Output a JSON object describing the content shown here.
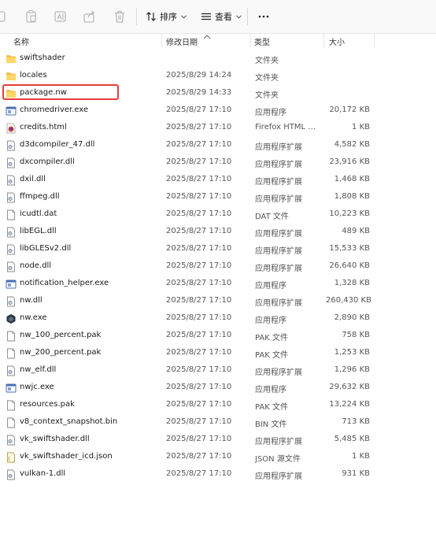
{
  "toolbar": {
    "sort_label": "排序",
    "view_label": "查看",
    "icons": [
      "copy-icon",
      "paste-icon",
      "rename-icon",
      "share-icon",
      "delete-icon",
      "sort-icon",
      "view-icon",
      "more-icon"
    ]
  },
  "columns": {
    "name": "名称",
    "date": "修改日期",
    "type": "类型",
    "size": "大小"
  },
  "highlight_color": "#e63c3c",
  "files": [
    {
      "name": "swiftshader",
      "date": "",
      "type": "文件夹",
      "size": "",
      "icon": "folder"
    },
    {
      "name": "locales",
      "date": "2025/8/29 14:24",
      "type": "文件夹",
      "size": "",
      "icon": "folder"
    },
    {
      "name": "package.nw",
      "date": "2025/8/29 14:33",
      "type": "文件夹",
      "size": "",
      "icon": "folder"
    },
    {
      "name": "chromedriver.exe",
      "date": "2025/8/27 17:10",
      "type": "应用程序",
      "size": "20,172 KB",
      "icon": "exe"
    },
    {
      "name": "credits.html",
      "date": "2025/8/27 17:10",
      "type": "Firefox HTML D...",
      "size": "1 KB",
      "icon": "html"
    },
    {
      "name": "d3dcompiler_47.dll",
      "date": "2025/8/27 17:10",
      "type": "应用程序扩展",
      "size": "4,582 KB",
      "icon": "dll"
    },
    {
      "name": "dxcompiler.dll",
      "date": "2025/8/27 17:10",
      "type": "应用程序扩展",
      "size": "23,916 KB",
      "icon": "dll"
    },
    {
      "name": "dxil.dll",
      "date": "2025/8/27 17:10",
      "type": "应用程序扩展",
      "size": "1,468 KB",
      "icon": "dll"
    },
    {
      "name": "ffmpeg.dll",
      "date": "2025/8/27 17:10",
      "type": "应用程序扩展",
      "size": "1,808 KB",
      "icon": "dll"
    },
    {
      "name": "icudtl.dat",
      "date": "2025/8/27 17:10",
      "type": "DAT 文件",
      "size": "10,223 KB",
      "icon": "file"
    },
    {
      "name": "libEGL.dll",
      "date": "2025/8/27 17:10",
      "type": "应用程序扩展",
      "size": "489 KB",
      "icon": "dll"
    },
    {
      "name": "libGLESv2.dll",
      "date": "2025/8/27 17:10",
      "type": "应用程序扩展",
      "size": "15,533 KB",
      "icon": "dll"
    },
    {
      "name": "node.dll",
      "date": "2025/8/27 17:10",
      "type": "应用程序扩展",
      "size": "26,640 KB",
      "icon": "dll"
    },
    {
      "name": "notification_helper.exe",
      "date": "2025/8/27 17:10",
      "type": "应用程序",
      "size": "1,328 KB",
      "icon": "exe"
    },
    {
      "name": "nw.dll",
      "date": "2025/8/27 17:10",
      "type": "应用程序扩展",
      "size": "260,430 KB",
      "icon": "dll"
    },
    {
      "name": "nw.exe",
      "date": "2025/8/27 17:10",
      "type": "应用程序",
      "size": "2,890 KB",
      "icon": "nwexe"
    },
    {
      "name": "nw_100_percent.pak",
      "date": "2025/8/27 17:10",
      "type": "PAK 文件",
      "size": "758 KB",
      "icon": "file"
    },
    {
      "name": "nw_200_percent.pak",
      "date": "2025/8/27 17:10",
      "type": "PAK 文件",
      "size": "1,253 KB",
      "icon": "file"
    },
    {
      "name": "nw_elf.dll",
      "date": "2025/8/27 17:10",
      "type": "应用程序扩展",
      "size": "1,296 KB",
      "icon": "dll"
    },
    {
      "name": "nwjc.exe",
      "date": "2025/8/27 17:10",
      "type": "应用程序",
      "size": "29,632 KB",
      "icon": "exe"
    },
    {
      "name": "resources.pak",
      "date": "2025/8/27 17:10",
      "type": "PAK 文件",
      "size": "13,224 KB",
      "icon": "file"
    },
    {
      "name": "v8_context_snapshot.bin",
      "date": "2025/8/27 17:10",
      "type": "BIN 文件",
      "size": "713 KB",
      "icon": "file"
    },
    {
      "name": "vk_swiftshader.dll",
      "date": "2025/8/27 17:10",
      "type": "应用程序扩展",
      "size": "5,485 KB",
      "icon": "dll"
    },
    {
      "name": "vk_swiftshader_icd.json",
      "date": "2025/8/27 17:10",
      "type": "JSON 源文件",
      "size": "1 KB",
      "icon": "json"
    },
    {
      "name": "vulkan-1.dll",
      "date": "2025/8/27 17:10",
      "type": "应用程序扩展",
      "size": "931 KB",
      "icon": "dll"
    }
  ]
}
